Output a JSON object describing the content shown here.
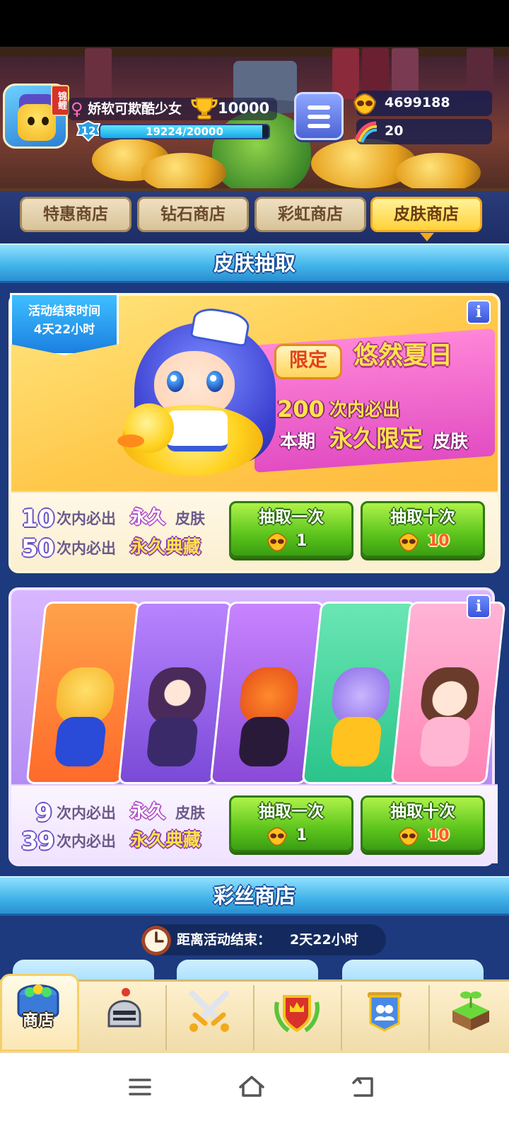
{
  "player": {
    "koi_badge": "锦鲤",
    "name": "娇软可欺酷少女",
    "trophies": "10000",
    "level": "12",
    "exp_text": "19224/20000",
    "exp_progress": 0.9612
  },
  "resources": {
    "gold_masks": "4699188",
    "rainbow_silk": "20"
  },
  "tabs": [
    {
      "label": "特惠商店",
      "active": false
    },
    {
      "label": "钻石商店",
      "active": false
    },
    {
      "label": "彩虹商店",
      "active": false
    },
    {
      "label": "皮肤商店",
      "active": true
    }
  ],
  "skin_draw": {
    "section_title": "皮肤抽取",
    "banner1": {
      "timer_label": "活动结束时间",
      "timer_value": "4天22小时",
      "limited_tag": "限定",
      "title": "悠然夏日",
      "guarantee_count": "200",
      "guarantee_text": "次内必出",
      "skin_prefix": "本期",
      "skin_highlight": "永久限定",
      "skin_suffix": "皮肤",
      "pity": [
        {
          "num": "10",
          "text": "次内必出",
          "highlight": "永久",
          "suffix": "皮肤"
        },
        {
          "num": "50",
          "text": "次内必出",
          "highlight": "永久典藏",
          "suffix": ""
        }
      ],
      "draw_once": {
        "label": "抽取一次",
        "cost": "1"
      },
      "draw_ten": {
        "label": "抽取十次",
        "cost": "10"
      }
    },
    "banner2": {
      "pity": [
        {
          "num": "9",
          "text": "次内必出",
          "highlight": "永久",
          "suffix": "皮肤"
        },
        {
          "num": "39",
          "text": "次内必出",
          "highlight": "永久典藏",
          "suffix": ""
        }
      ],
      "draw_once": {
        "label": "抽取一次",
        "cost": "1"
      },
      "draw_ten": {
        "label": "抽取十次",
        "cost": "10"
      }
    }
  },
  "silk_shop": {
    "section_title": "彩丝商店",
    "countdown_label": "距离活动结束：",
    "countdown_value": "2天22小时"
  },
  "bottom_nav": {
    "shop_label": "商店",
    "items": [
      "shop-chest-icon",
      "knight-helmet-icon",
      "crossed-swords-icon",
      "crown-shield-icon",
      "team-banner-icon",
      "sprout-island-icon"
    ]
  },
  "colors": {
    "header_blue": "#3fb2e8",
    "draw_green": "#5cc41c",
    "tab_active": "#ffd23a",
    "background_navy": "#1d3a7e"
  }
}
